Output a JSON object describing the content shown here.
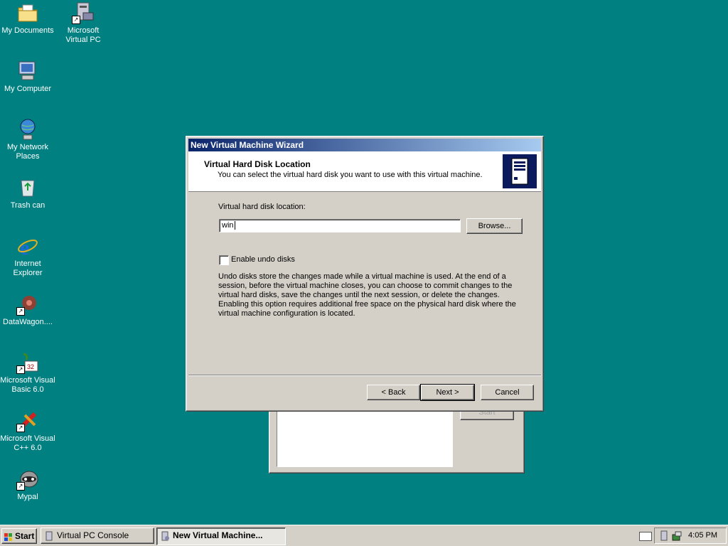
{
  "desktop": {
    "icons": [
      {
        "label": "My Documents",
        "icon": "folder-documents-icon"
      },
      {
        "label": "Microsoft Virtual PC",
        "icon": "virtual-pc-icon"
      },
      {
        "label": "My Computer",
        "icon": "computer-icon"
      },
      {
        "label": "My Network Places",
        "icon": "network-places-icon"
      },
      {
        "label": "Trash can",
        "icon": "recycle-bin-icon"
      },
      {
        "label": "Internet Explorer",
        "icon": "internet-explorer-icon"
      },
      {
        "label": "DataWagon....",
        "icon": "datawagon-icon"
      },
      {
        "label": "Microsoft Visual Basic 6.0",
        "icon": "visual-basic-icon"
      },
      {
        "label": "Microsoft Visual C++ 6.0",
        "icon": "visual-cpp-icon"
      },
      {
        "label": "Mypal",
        "icon": "mypal-browser-icon"
      }
    ]
  },
  "background_window": {
    "button_label": "Start"
  },
  "wizard": {
    "title": "New Virtual Machine Wizard",
    "header_title": "Virtual Hard Disk Location",
    "header_subtitle": "You can select the virtual hard disk you want to use with this virtual machine.",
    "location_label": "Virtual hard disk location:",
    "location_value": "win",
    "browse_label": "Browse...",
    "undo_checkbox_label": "Enable undo disks",
    "undo_checked": false,
    "description": "Undo disks store the changes made while a virtual machine is used. At the end of a session, before the virtual machine closes, you can choose to commit changes to the virtual hard disks, save the changes until the next session, or delete the changes. Enabling this option requires additional free space on the physical hard disk where the virtual machine configuration is located.",
    "back_label": "< Back",
    "next_label": "Next >",
    "cancel_label": "Cancel"
  },
  "taskbar": {
    "start_label": "Start",
    "tasks": [
      {
        "label": "Virtual PC Console",
        "active": false
      },
      {
        "label": "New Virtual Machine...",
        "active": true
      }
    ],
    "clock": "4:05 PM"
  },
  "colors": {
    "desktop": "#008080",
    "title_active_start": "#0a246a",
    "title_active_end": "#a6caf0",
    "face": "#d4d0c8"
  }
}
